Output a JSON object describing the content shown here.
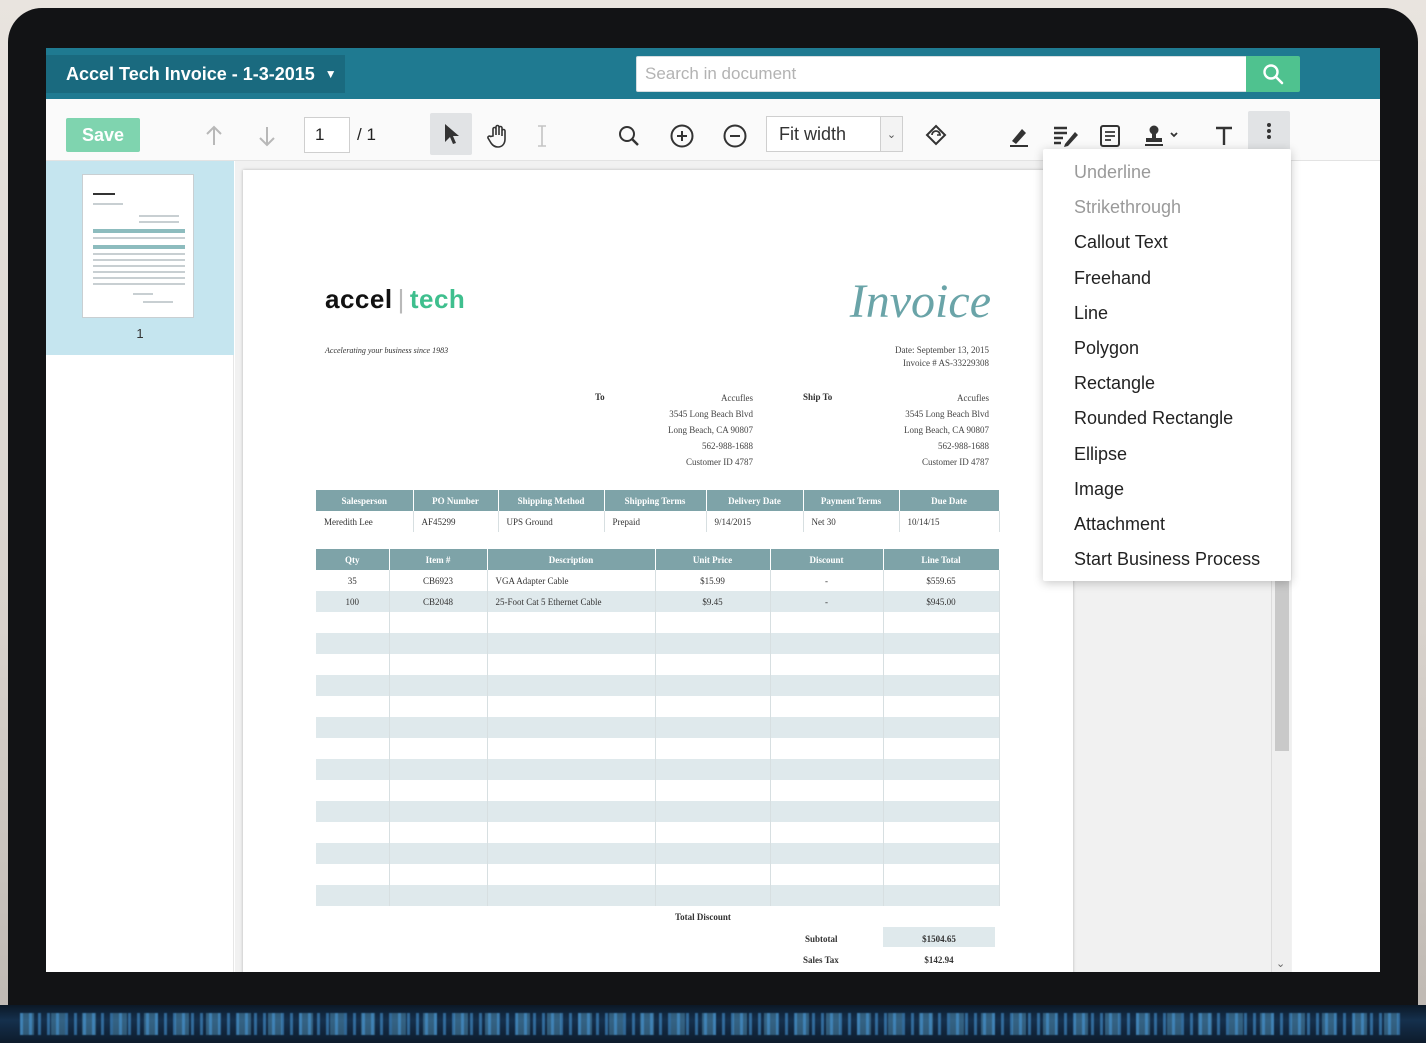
{
  "header": {
    "doc_title": "Accel Tech Invoice - 1-3-2015",
    "search_placeholder": "Search in document"
  },
  "toolbar": {
    "save_label": "Save",
    "page_current": "1",
    "page_total": "/ 1",
    "zoom_mode": "Fit width"
  },
  "sidebar": {
    "thumb_page_number": "1"
  },
  "annotation_menu": {
    "items": [
      {
        "label": "Underline",
        "enabled": false
      },
      {
        "label": "Strikethrough",
        "enabled": false
      },
      {
        "label": "Callout Text",
        "enabled": true
      },
      {
        "label": "Freehand",
        "enabled": true
      },
      {
        "label": "Line",
        "enabled": true
      },
      {
        "label": "Polygon",
        "enabled": true
      },
      {
        "label": "Rectangle",
        "enabled": true
      },
      {
        "label": "Rounded Rectangle",
        "enabled": true
      },
      {
        "label": "Ellipse",
        "enabled": true
      },
      {
        "label": "Image",
        "enabled": true
      },
      {
        "label": "Attachment",
        "enabled": true
      },
      {
        "label": "Start Business Process",
        "enabled": true
      }
    ]
  },
  "invoice": {
    "logo_left": "accel",
    "logo_right": "tech",
    "tagline": "Accelerating your business since 1983",
    "title": "Invoice",
    "date": "Date: September 13, 2015",
    "invoice_no": "Invoice # AS-33229308",
    "to_label": "To",
    "to_lines": [
      "Accufles",
      "3545 Long Beach Blvd",
      "Long Beach, CA 90807",
      "562-988-1688",
      "Customer ID 4787"
    ],
    "ship_label": "Ship To",
    "ship_lines": [
      "Accufles",
      "3545 Long Beach Blvd",
      "Long Beach, CA 90807",
      "562-988-1688",
      "Customer ID 4787"
    ],
    "order_headers": [
      "Salesperson",
      "PO Number",
      "Shipping Method",
      "Shipping Terms",
      "Delivery Date",
      "Payment Terms",
      "Due Date"
    ],
    "order_values": [
      "Meredith Lee",
      "AF45299",
      "UPS Ground",
      "Prepaid",
      "9/14/2015",
      "Net 30",
      "10/14/15"
    ],
    "item_headers": [
      "Qty",
      "Item #",
      "Description",
      "Unit Price",
      "Discount",
      "Line Total"
    ],
    "items": [
      [
        "35",
        "CB6923",
        "VGA Adapter Cable",
        "$15.99",
        "-",
        "$559.65"
      ],
      [
        "100",
        "CB2048",
        "25-Foot Cat 5 Ethernet Cable",
        "$9.45",
        "-",
        "$945.00"
      ]
    ],
    "total_discount_label": "Total Discount",
    "subtotal_label": "Subtotal",
    "subtotal_value": "$1504.65",
    "sales_tax_label": "Sales Tax",
    "sales_tax_value": "$142.94"
  },
  "colors": {
    "topbar": "#1f7a91",
    "accent_green": "#4fc28f",
    "table_header": "#7ea3a8",
    "sidebar_selected": "#c5e5ef"
  }
}
